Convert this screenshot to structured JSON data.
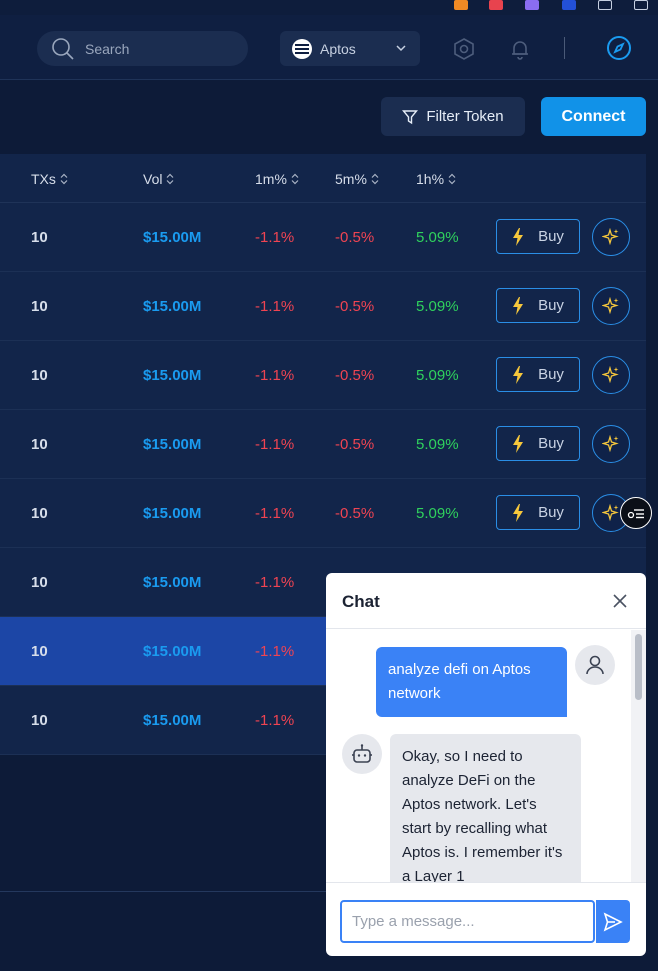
{
  "colors": {
    "accent": "#1192e8",
    "volume": "#1a9bf0",
    "negative": "#f04452",
    "positive": "#2fd15d",
    "selected_row": "#1c46a6",
    "lightning": "#f7c83c"
  },
  "header": {
    "search": {
      "placeholder": "Search",
      "icon": "search-icon"
    },
    "network": {
      "label": "Aptos",
      "icon": "aptos-logo-icon"
    },
    "icons": [
      "hexagon-icon",
      "bell-icon",
      "compass-icon"
    ]
  },
  "toolbar": {
    "filter_label": "Filter Token",
    "connect_label": "Connect"
  },
  "table": {
    "columns": [
      "TXs",
      "Vol",
      "1m%",
      "5m%",
      "1h%"
    ],
    "buy_label": "Buy",
    "rows": [
      {
        "txs": "10",
        "vol": "$15.00M",
        "m1": "-1.1%",
        "m5": "-0.5%",
        "h1": "5.09%"
      },
      {
        "txs": "10",
        "vol": "$15.00M",
        "m1": "-1.1%",
        "m5": "-0.5%",
        "h1": "5.09%"
      },
      {
        "txs": "10",
        "vol": "$15.00M",
        "m1": "-1.1%",
        "m5": "-0.5%",
        "h1": "5.09%"
      },
      {
        "txs": "10",
        "vol": "$15.00M",
        "m1": "-1.1%",
        "m5": "-0.5%",
        "h1": "5.09%"
      },
      {
        "txs": "10",
        "vol": "$15.00M",
        "m1": "-1.1%",
        "m5": "-0.5%",
        "h1": "5.09%"
      },
      {
        "txs": "10",
        "vol": "$15.00M",
        "m1": "-1.1%"
      },
      {
        "txs": "10",
        "vol": "$15.00M",
        "m1": "-1.1%"
      },
      {
        "txs": "10",
        "vol": "$15.00M",
        "m1": "-1.1%"
      }
    ]
  },
  "chat": {
    "title": "Chat",
    "user_message": "analyze defi on Aptos network",
    "bot_message": "Okay, so I need to analyze DeFi on the Aptos network. Let's start by recalling what Aptos is. I remember it's a Layer 1",
    "input_placeholder": "Type a message..."
  }
}
